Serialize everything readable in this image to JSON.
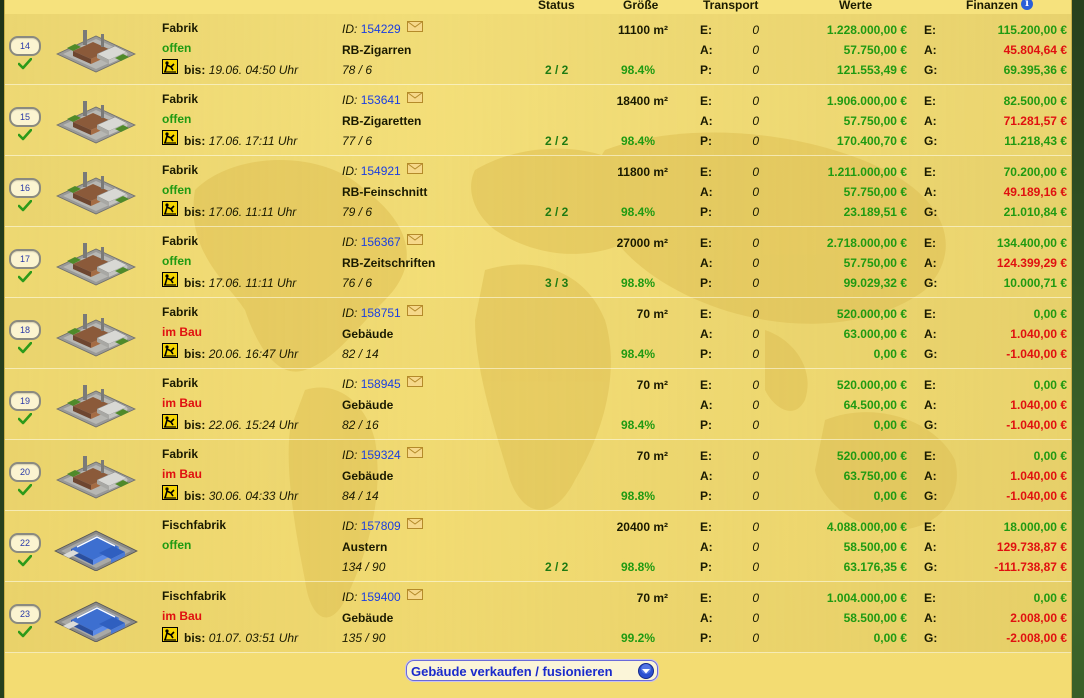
{
  "header": {
    "status": "Status",
    "groesse": "Größe",
    "transport": "Transport",
    "werte": "Werte",
    "finanzen": "Finanzen",
    "info_glyph": "i"
  },
  "labels": {
    "until": "bis:",
    "id": "ID:",
    "E": "E:",
    "A": "A:",
    "P": "P:",
    "G": "G:"
  },
  "rows": [
    {
      "num": "14",
      "icon": "factory",
      "type": "Fabrik",
      "state": "offen",
      "state_kind": "open",
      "until": "19.06. 04:50 Uhr",
      "id": "154229",
      "name": "RB-Zigarren",
      "ratio": "78 / 6",
      "status": "2 / 2",
      "area": "11100 m²",
      "pct": "98.4%",
      "t_e": "0",
      "t_a": "0",
      "t_p": "0",
      "w_e": "1.228.000,00 €",
      "w_a": "57.750,00 €",
      "w_p": "121.553,49 €",
      "f_e": "115.200,00 €",
      "f_a": "45.804,64 €",
      "f_g": "69.395,36 €",
      "f_g_kind": "green"
    },
    {
      "num": "15",
      "icon": "factory",
      "type": "Fabrik",
      "state": "offen",
      "state_kind": "open",
      "until": "17.06. 17:11 Uhr",
      "id": "153641",
      "name": "RB-Zigaretten",
      "ratio": "77 / 6",
      "status": "2 / 2",
      "area": "18400 m²",
      "pct": "98.4%",
      "t_e": "0",
      "t_a": "0",
      "t_p": "0",
      "w_e": "1.906.000,00 €",
      "w_a": "57.750,00 €",
      "w_p": "170.400,70 €",
      "f_e": "82.500,00 €",
      "f_a": "71.281,57 €",
      "f_g": "11.218,43 €",
      "f_g_kind": "green"
    },
    {
      "num": "16",
      "icon": "factory",
      "type": "Fabrik",
      "state": "offen",
      "state_kind": "open",
      "until": "17.06. 11:11 Uhr",
      "id": "154921",
      "name": "RB-Feinschnitt",
      "ratio": "79 / 6",
      "status": "2 / 2",
      "area": "11800 m²",
      "pct": "98.4%",
      "t_e": "0",
      "t_a": "0",
      "t_p": "0",
      "w_e": "1.211.000,00 €",
      "w_a": "57.750,00 €",
      "w_p": "23.189,51 €",
      "f_e": "70.200,00 €",
      "f_a": "49.189,16 €",
      "f_g": "21.010,84 €",
      "f_g_kind": "green"
    },
    {
      "num": "17",
      "icon": "factory",
      "type": "Fabrik",
      "state": "offen",
      "state_kind": "open",
      "until": "17.06. 11:11 Uhr",
      "id": "156367",
      "name": "RB-Zeitschriften",
      "ratio": "76 / 6",
      "status": "3 / 3",
      "area": "27000 m²",
      "pct": "98.8%",
      "t_e": "0",
      "t_a": "0",
      "t_p": "0",
      "w_e": "2.718.000,00 €",
      "w_a": "57.750,00 €",
      "w_p": "99.029,32 €",
      "f_e": "134.400,00 €",
      "f_a": "124.399,29 €",
      "f_g": "10.000,71 €",
      "f_g_kind": "green"
    },
    {
      "num": "18",
      "icon": "factory",
      "type": "Fabrik",
      "state": "im Bau",
      "state_kind": "build",
      "until": "20.06. 16:47 Uhr",
      "id": "158751",
      "name": "Gebäude",
      "ratio": "82 / 14",
      "status": "",
      "area": "70 m²",
      "pct": "98.4%",
      "t_e": "0",
      "t_a": "0",
      "t_p": "0",
      "w_e": "520.000,00 €",
      "w_a": "63.000,00 €",
      "w_p": "0,00 €",
      "f_e": "0,00 €",
      "f_a": "1.040,00 €",
      "f_g": "-1.040,00 €",
      "f_g_kind": "red"
    },
    {
      "num": "19",
      "icon": "factory",
      "type": "Fabrik",
      "state": "im Bau",
      "state_kind": "build",
      "until": "22.06. 15:24 Uhr",
      "id": "158945",
      "name": "Gebäude",
      "ratio": "82 / 16",
      "status": "",
      "area": "70 m²",
      "pct": "98.4%",
      "t_e": "0",
      "t_a": "0",
      "t_p": "0",
      "w_e": "520.000,00 €",
      "w_a": "64.500,00 €",
      "w_p": "0,00 €",
      "f_e": "0,00 €",
      "f_a": "1.040,00 €",
      "f_g": "-1.040,00 €",
      "f_g_kind": "red"
    },
    {
      "num": "20",
      "icon": "factory",
      "type": "Fabrik",
      "state": "im Bau",
      "state_kind": "build",
      "until": "30.06. 04:33 Uhr",
      "id": "159324",
      "name": "Gebäude",
      "ratio": "84 / 14",
      "status": "",
      "area": "70 m²",
      "pct": "98.8%",
      "t_e": "0",
      "t_a": "0",
      "t_p": "0",
      "w_e": "520.000,00 €",
      "w_a": "63.750,00 €",
      "w_p": "0,00 €",
      "f_e": "0,00 €",
      "f_a": "1.040,00 €",
      "f_g": "-1.040,00 €",
      "f_g_kind": "red"
    },
    {
      "num": "22",
      "icon": "fishfactory",
      "type": "Fischfabrik",
      "state": "offen",
      "state_kind": "open",
      "until": "",
      "id": "157809",
      "name": "Austern",
      "ratio": "134 / 90",
      "status": "2 / 2",
      "area": "20400 m²",
      "pct": "98.8%",
      "t_e": "0",
      "t_a": "0",
      "t_p": "0",
      "w_e": "4.088.000,00 €",
      "w_a": "58.500,00 €",
      "w_p": "63.176,35 €",
      "f_e": "18.000,00 €",
      "f_a": "129.738,87 €",
      "f_g": "-111.738,87 €",
      "f_g_kind": "red"
    },
    {
      "num": "23",
      "icon": "fishfactory",
      "type": "Fischfabrik",
      "state": "im Bau",
      "state_kind": "build",
      "until": "01.07. 03:51 Uhr",
      "id": "159400",
      "name": "Gebäude",
      "ratio": "135 / 90",
      "status": "",
      "area": "70 m²",
      "pct": "99.2%",
      "t_e": "0",
      "t_a": "0",
      "t_p": "0",
      "w_e": "1.004.000,00 €",
      "w_a": "58.500,00 €",
      "w_p": "0,00 €",
      "f_e": "0,00 €",
      "f_a": "2.008,00 €",
      "f_g": "-2.008,00 €",
      "f_g_kind": "red"
    }
  ],
  "footer": {
    "button_label": "Gebäude verkaufen / fusionieren"
  },
  "colors": {
    "panel": "#f6e27d",
    "green": "#1f9a12",
    "red": "#e01010",
    "link": "#1a3ee0"
  }
}
